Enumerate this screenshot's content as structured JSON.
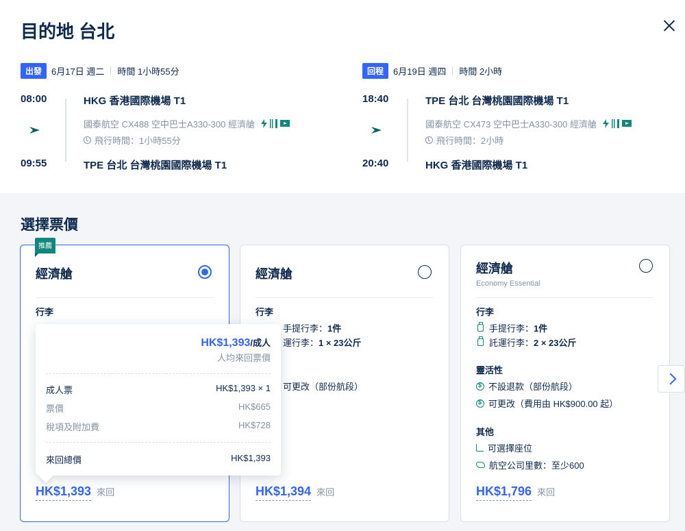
{
  "page": {
    "title": "目的地 台北"
  },
  "colors": {
    "brand_blue": "#3264ff",
    "navy": "#0f294d",
    "teal": "#11867b",
    "gray": "#8592a6"
  },
  "outbound": {
    "tag": "出發",
    "date": "6月17日 週二",
    "duration_label": "時間 1小時55分",
    "dep_time": "08:00",
    "dep_airport": "HKG 香港國際機場 T1",
    "airline_info": "國泰航空  CX488  空中巴士A330-300  經濟艙",
    "flight_time": "飛行時間：1小時55分",
    "arr_time": "09:55",
    "arr_airport": "TPE 台北 台灣桃園國際機場 T1"
  },
  "return": {
    "tag": "回程",
    "date": "6月19日 週四",
    "duration_label": "時間 2小時",
    "dep_time": "18:40",
    "dep_airport": "TPE 台北 台灣桃園國際機場 T1",
    "airline_info": "國泰航空  CX473  空中巴士A330-300  經濟艙",
    "flight_time": "飛行時間：2小時",
    "arr_time": "20:40",
    "arr_airport": "HKG 香港國際機場 T1"
  },
  "section_title": "選擇票價",
  "fares": [
    {
      "badge": "推薦",
      "cabin": "經濟艙",
      "selected": true,
      "baggage_title": "行李",
      "price": "HK$1,393",
      "trip": "來回"
    },
    {
      "cabin": "經濟艙",
      "selected": false,
      "baggage_title": "行李",
      "carry_on_tail": "手提行李：",
      "carry_on_val": "1件",
      "checked_tail": "運行李：",
      "checked_val": "1 × 23公斤",
      "flex_tail": "可更改（部份航段）",
      "price": "HK$1,394",
      "trip": "來回"
    },
    {
      "cabin": "經濟艙",
      "subtitle": "Economy Essential",
      "selected": false,
      "baggage_title": "行李",
      "carry_on": "手提行李：",
      "carry_on_val": "1件",
      "checked": "託運行李：",
      "checked_val": "2 × 23公斤",
      "flex_title": "靈活性",
      "refund": "不設退款（部份航段）",
      "change": "可更改（費用由 HK$900.00 起）",
      "other_title": "其他",
      "seat": "可選擇座位",
      "miles": "航空公司里數：至少600",
      "price": "HK$1,796",
      "trip": "來回"
    }
  ],
  "popover": {
    "price": "HK$1,393",
    "per": "/成人",
    "sub": "人均來回票價",
    "adult_label": "成人票",
    "adult_value": "HK$1,393 × 1",
    "fare_label": "票價",
    "fare_value": "HK$665",
    "tax_label": "稅項及附加費",
    "tax_value": "HK$728",
    "total_label": "來回總價",
    "total_value": "HK$1,393"
  }
}
